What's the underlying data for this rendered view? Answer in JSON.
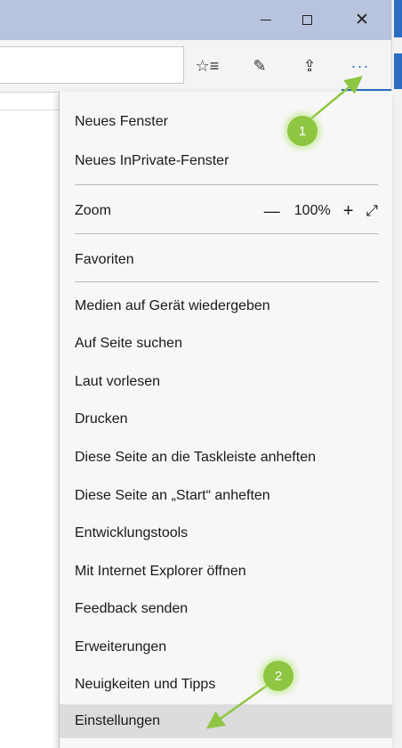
{
  "window": {
    "minimize_icon": "minimize-icon",
    "maximize_icon": "maximize-icon",
    "close_glyph": "✕"
  },
  "toolbar": {
    "favorites_glyph": "☆≡",
    "notes_glyph": "✎",
    "share_glyph": "⇪",
    "more_glyph": "···",
    "accent_color": "#2b6cc4"
  },
  "menu": {
    "new_window": "Neues Fenster",
    "new_inprivate": "Neues InPrivate-Fenster",
    "zoom_label": "Zoom",
    "zoom_minus": "—",
    "zoom_value": "100%",
    "zoom_plus": "+",
    "zoom_fullscreen": "⤢",
    "favorites": "Favoriten",
    "items": [
      "Medien auf Gerät wiedergeben",
      "Auf Seite suchen",
      "Laut vorlesen",
      "Drucken",
      "Diese Seite an die Taskleiste anheften",
      "Diese Seite an „Start“ anheften",
      "Entwicklungstools",
      "Mit Internet Explorer öffnen",
      "Feedback senden",
      "Erweiterungen",
      "Neuigkeiten und Tipps",
      "Einstellungen"
    ]
  },
  "annotations": {
    "badge1": "1",
    "badge2": "2",
    "color": "#8ec641"
  }
}
